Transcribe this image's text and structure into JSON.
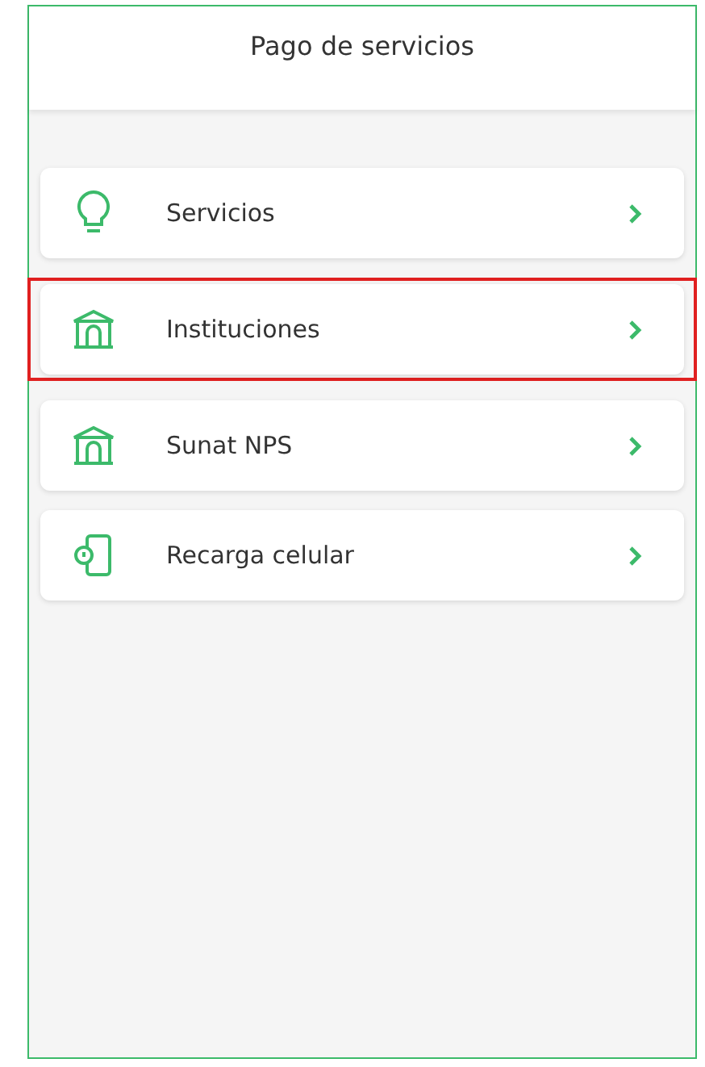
{
  "header": {
    "title": "Pago de servicios"
  },
  "items": [
    {
      "label": "Servicios",
      "kind": "bulb",
      "highlighted": false
    },
    {
      "label": "Instituciones",
      "kind": "building",
      "highlighted": true
    },
    {
      "label": "Sunat NPS",
      "kind": "building",
      "highlighted": false
    },
    {
      "label": "Recarga celular",
      "kind": "phone",
      "highlighted": false
    }
  ]
}
